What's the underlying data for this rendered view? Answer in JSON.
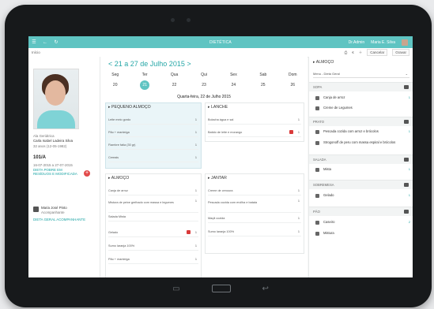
{
  "topbar": {
    "app_title": "DIETÉTICA",
    "user_left": "Dr.Admin",
    "user_right": "Maria E. Silva"
  },
  "subbar": {
    "breadcrumb": "Início",
    "btn_cancel": "Cancelar",
    "btn_save": "Gravar"
  },
  "patient": {
    "label": "Ala Geriátrica",
    "name": "Carla Isabel Ladeira Silva",
    "age_line": "32 anos (12-05-1982)",
    "bed": "101/A",
    "admission": "16-07-2015 a 27-07-2015",
    "diet": "DIETA POBRE EM RESÍDUOS E MODIFICADA",
    "resp_label": "Maria José Pinto",
    "resp_sub": "Acompanhante",
    "resp_diet": "DIETA GERAL ACOMPANHANTE"
  },
  "week": {
    "title": "< 21 a 27 de Julho 2015 >",
    "days": [
      {
        "name": "Seg",
        "num": "20"
      },
      {
        "name": "Ter",
        "num": "21"
      },
      {
        "name": "Qua",
        "num": "22"
      },
      {
        "name": "Qui",
        "num": "23"
      },
      {
        "name": "Sex",
        "num": "24"
      },
      {
        "name": "Sab",
        "num": "25"
      },
      {
        "name": "Dom",
        "num": "26"
      }
    ],
    "selected_line": "Quarta-feira, 22 de Julho 2015"
  },
  "meals": {
    "pequeno_almoco": {
      "title": "PEQUENO ALMOÇO",
      "rows": [
        {
          "label": "Leite meio gordo",
          "qty": "1"
        },
        {
          "label": "Pão + manteiga",
          "qty": "1"
        },
        {
          "label": "Fiambre fatia (30 gr)",
          "qty": "1"
        },
        {
          "label": "Cereais",
          "qty": "1"
        }
      ]
    },
    "lanche": {
      "title": "LANCHE",
      "rows": [
        {
          "label": "Bolacha água e sal",
          "qty": "1"
        },
        {
          "label": "Batido de leite e morango",
          "qty": "1"
        }
      ]
    },
    "almoco": {
      "title": "ALMOÇO",
      "rows": [
        {
          "label": "Canja de arroz",
          "qty": "1"
        },
        {
          "label": "Mistura de peixe grelhado com massa e legumes",
          "qty": "1"
        },
        {
          "label": "Salada Mista",
          "qty": ""
        },
        {
          "label": "Gelado",
          "qty": "1"
        },
        {
          "label": "Sumo laranja 100%",
          "qty": "1"
        },
        {
          "label": "Pão + manteiga",
          "qty": "1"
        }
      ]
    },
    "jantar": {
      "title": "JANTAR",
      "rows": [
        {
          "label": "Creme de cenoura",
          "qty": "1"
        },
        {
          "label": "Pescada cozida com ervilha e batata",
          "qty": "1"
        },
        {
          "label": "Maçã cozida",
          "qty": "1"
        },
        {
          "label": "Sumo laranja 100%",
          "qty": "1"
        }
      ]
    }
  },
  "right": {
    "title": "ALMOÇO",
    "select": "Menu - Dieta Geral",
    "sections": [
      {
        "name": "SOPA",
        "items": [
          {
            "label": "Canja de arroz",
            "qty": "1"
          },
          {
            "label": "Creme de Legumes",
            "qty": ""
          }
        ]
      },
      {
        "name": "PRATO",
        "items": [
          {
            "label": "Pescada cozida com arroz e brócolos",
            "qty": "1"
          },
          {
            "label": "Strogonoff de peru com massa espiral e brócolos",
            "qty": ""
          }
        ]
      },
      {
        "name": "SALADA",
        "items": [
          {
            "label": "Mista",
            "qty": "1"
          }
        ]
      },
      {
        "name": "SOBREMESA",
        "items": [
          {
            "label": "Gelado",
            "qty": "1"
          }
        ]
      },
      {
        "name": "PÃO",
        "items": [
          {
            "label": "Caseiro",
            "qty": "2"
          },
          {
            "label": "Mistura",
            "qty": ""
          }
        ]
      }
    ]
  }
}
